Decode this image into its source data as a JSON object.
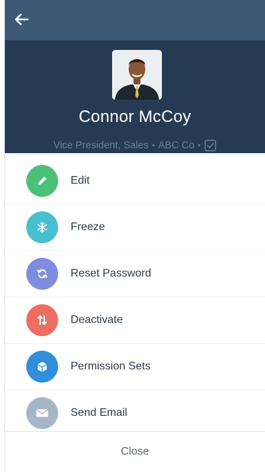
{
  "header": {
    "back_icon": "arrow-left-icon",
    "name": "Connor McCoy",
    "title": "Vice President, Sales",
    "separator": "•",
    "company": "ABC Co",
    "verified_icon": "checkbox-checked-icon"
  },
  "actions": [
    {
      "label": "Edit",
      "icon": "pencil-icon",
      "color": "#4bc076"
    },
    {
      "label": "Freeze",
      "icon": "snowflake-icon",
      "color": "#46bfcf"
    },
    {
      "label": "Reset Password",
      "icon": "refresh-icon",
      "color": "#7f8ce0"
    },
    {
      "label": "Deactivate",
      "icon": "arrows-up-down-icon",
      "color": "#ef6e64"
    },
    {
      "label": "Permission Sets",
      "icon": "cube-icon",
      "color": "#2f8fdb"
    },
    {
      "label": "Send Email",
      "icon": "envelope-icon",
      "color": "#a5b6c8"
    }
  ],
  "footer": {
    "close_label": "Close"
  },
  "colors": {
    "topbar": "#3e5976",
    "header": "#243b53",
    "subtitle": "#6b819a"
  }
}
